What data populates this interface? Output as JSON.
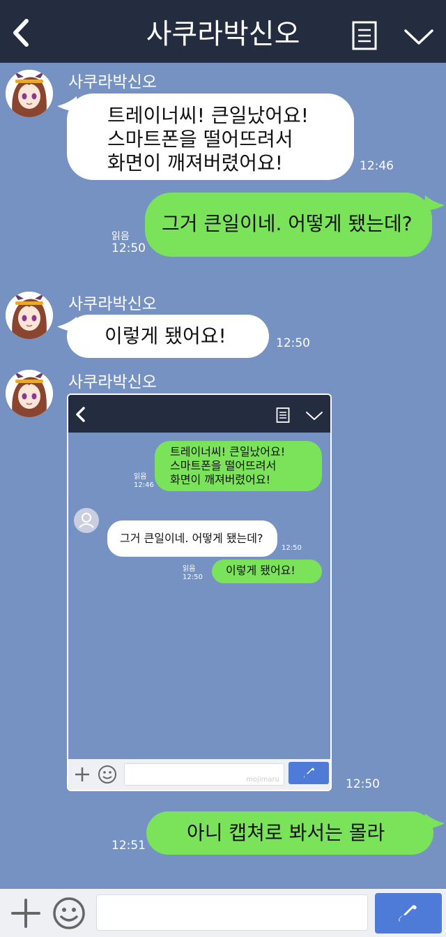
{
  "header": {
    "title": "사쿠라박신오",
    "back_icon": "chevron-left-icon",
    "menu_icon": "menu-icon",
    "collapse_icon": "chevron-down-icon"
  },
  "messages": [
    {
      "sender": "사쿠라박신오",
      "text": "트레이너씨! 큰일났어요!\n스마트폰을 떨어뜨려서\n화면이 깨져버렸어요!",
      "time": "12:46"
    },
    {
      "read": "읽음",
      "text": "그거 큰일이네. 어떻게 됐는데?",
      "time": "12:50"
    },
    {
      "sender": "사쿠라박신오",
      "text": "이렇게 됐어요!",
      "time": "12:50"
    },
    {
      "sender": "사쿠라박신오",
      "time": "12:50"
    },
    {
      "text": "아니 캡쳐로 봐서는 몰라",
      "time": "12:51"
    }
  ],
  "screenshot": {
    "messages": [
      {
        "read": "읽음",
        "time": "12:46",
        "text": "트레이너씨! 큰일났어요!\n스마트폰을 떨어뜨려서\n화면이 깨져버렸어요!"
      },
      {
        "text": "그거 큰일이네. 어떻게 됐는데?",
        "time": "12:50"
      },
      {
        "read": "읽음",
        "time": "12:50",
        "text": "이렇게 됐어요!"
      }
    ],
    "watermark": "mojimaru"
  },
  "input_bar": {
    "plus_icon": "plus-icon",
    "emoji_icon": "emoji-icon",
    "send_icon": "phone-icon",
    "placeholder": ""
  },
  "colors": {
    "background": "#7592c3",
    "header": "#242c40",
    "bubble_incoming": "#ffffff",
    "bubble_outgoing": "#7ae35a",
    "send_button": "#4f7bd8"
  }
}
